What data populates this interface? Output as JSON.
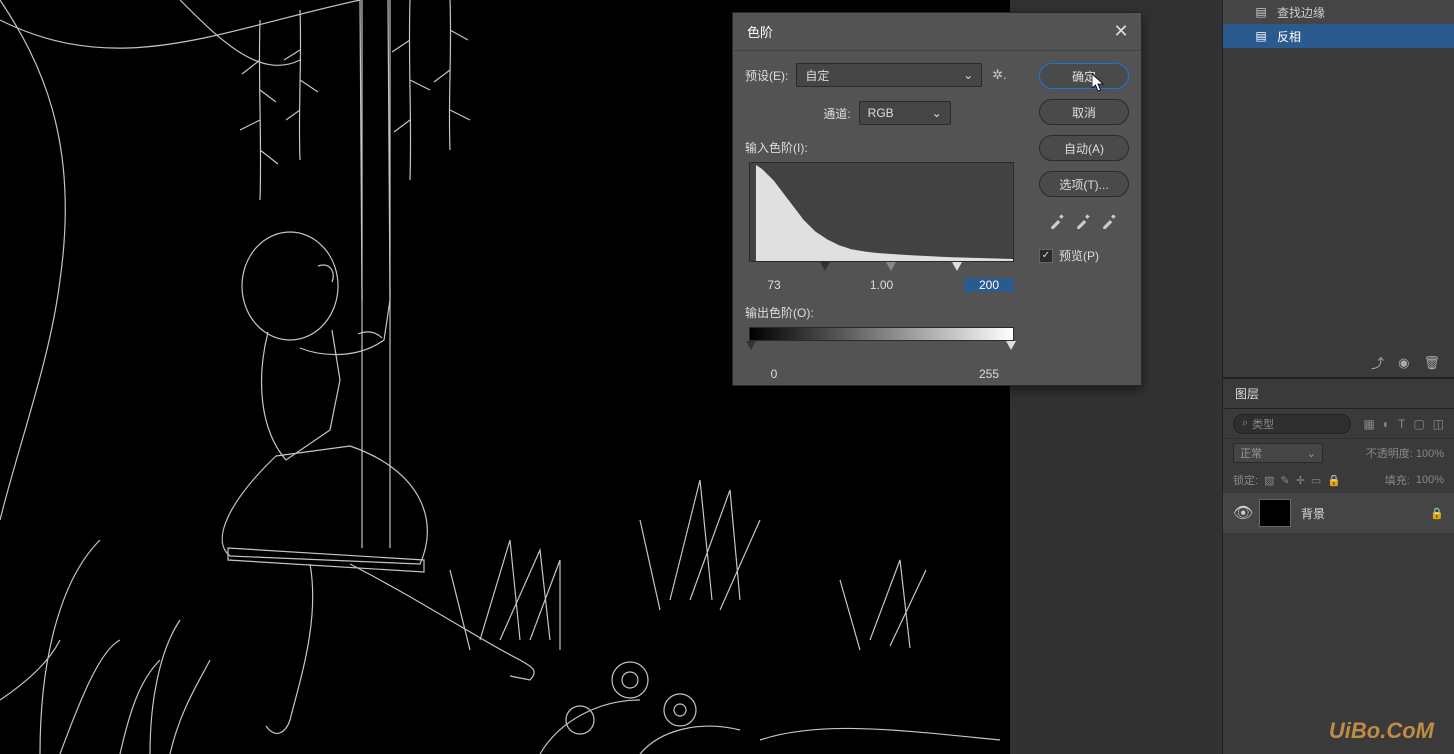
{
  "dialog": {
    "title": "色阶",
    "preset_label": "预设(E):",
    "preset_value": "自定",
    "channel_label": "通道:",
    "channel_value": "RGB",
    "input_label": "输入色阶(I):",
    "output_label": "输出色阶(O):",
    "input_black": "73",
    "input_gamma": "1.00",
    "input_white": "200",
    "output_black": "0",
    "output_white": "255",
    "ok": "确定",
    "cancel": "取消",
    "auto": "自动(A)",
    "options": "选项(T)...",
    "preview": "预览(P)"
  },
  "history": {
    "items": [
      {
        "label": "查找边缘",
        "selected": false,
        "icon": "filter"
      },
      {
        "label": "反相",
        "selected": true,
        "icon": "filter"
      }
    ]
  },
  "layers": {
    "tab": "图层",
    "search_placeholder": "类型",
    "blend_mode": "正常",
    "opacity_label": "不透明度:",
    "opacity_value": "100%",
    "lock_label": "锁定:",
    "fill_label": "填充:",
    "fill_value": "100%",
    "items": [
      {
        "name": "背景",
        "locked": true
      }
    ]
  },
  "watermark": "UiBo.CoM"
}
